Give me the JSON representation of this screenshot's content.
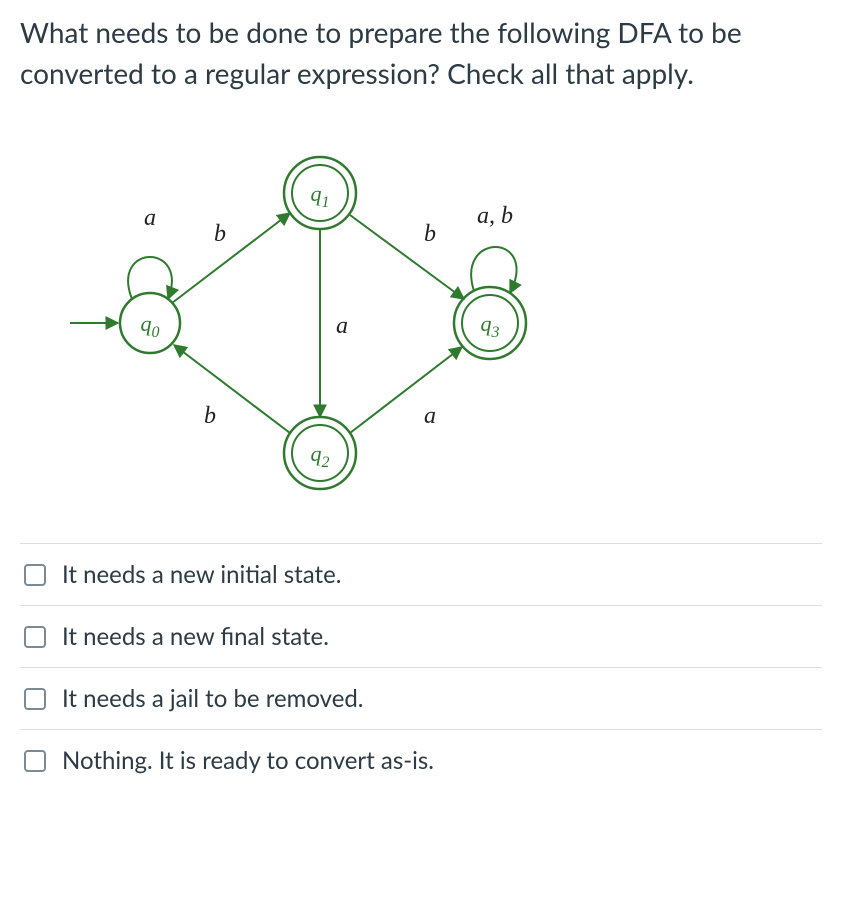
{
  "question": "What needs to be done to prepare the following DFA to be converted to a regular expression? Check all that apply.",
  "dfa": {
    "states": {
      "q0": {
        "name": "q",
        "sub": "0"
      },
      "q1": {
        "name": "q",
        "sub": "1"
      },
      "q2": {
        "name": "q",
        "sub": "2"
      },
      "q3": {
        "name": "q",
        "sub": "3"
      }
    },
    "edges": {
      "q0_loop": "a",
      "q0_q1": "b",
      "q1_q3": "b",
      "q1_q2": "a",
      "q0_q2": "b",
      "q2_q3": "a",
      "q3_loop": "a, b"
    }
  },
  "options": [
    {
      "label": "It needs a new initial state."
    },
    {
      "label": "It needs a new final state."
    },
    {
      "label": "It needs a jail to be removed."
    },
    {
      "label": "Nothing. It is ready to convert as-is."
    }
  ]
}
